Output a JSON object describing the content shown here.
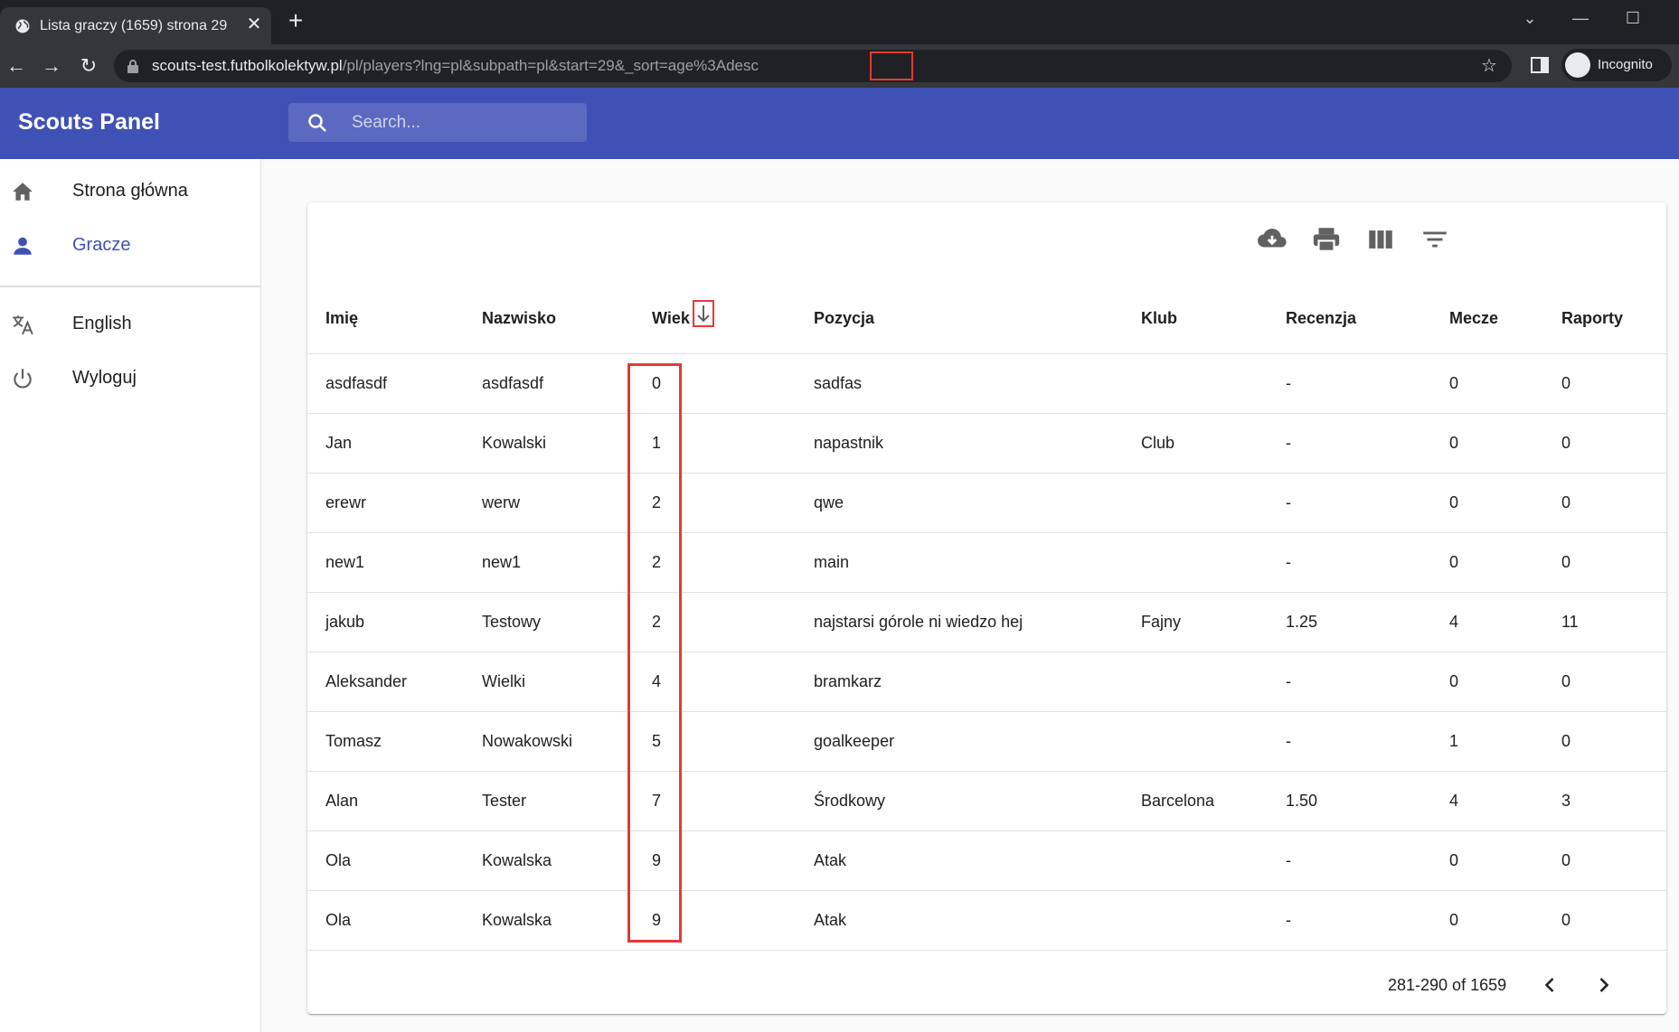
{
  "browser": {
    "tab_title": "Lista graczy (1659) strona 29",
    "url_host": "scouts-test.futbolkolektyw.pl",
    "url_path": "/pl/players?lng=pl&subpath=pl&start=29&_sort=age%3A",
    "url_highlight": "desc",
    "profile_label": "Incognito"
  },
  "app": {
    "title": "Scouts Panel",
    "search_placeholder": "Search..."
  },
  "sidebar": {
    "items": [
      {
        "label": "Strona główna",
        "icon": "home-icon"
      },
      {
        "label": "Gracze",
        "icon": "person-icon",
        "active": true
      },
      {
        "label": "English",
        "icon": "translate-icon"
      },
      {
        "label": "Wyloguj",
        "icon": "power-icon"
      }
    ]
  },
  "table": {
    "columns": [
      "Imię",
      "Nazwisko",
      "Wiek",
      "Pozycja",
      "Klub",
      "Recenzja",
      "Mecze",
      "Raporty"
    ],
    "rows": [
      [
        "asdfasdf",
        "asdfasdf",
        "0",
        "sadfas",
        "",
        "-",
        "0",
        "0"
      ],
      [
        "Jan",
        "Kowalski",
        "1",
        "napastnik",
        "Club",
        "-",
        "0",
        "0"
      ],
      [
        "erewr",
        "werw",
        "2",
        "qwe",
        "",
        "-",
        "0",
        "0"
      ],
      [
        "new1",
        "new1",
        "2",
        "main",
        "",
        "-",
        "0",
        "0"
      ],
      [
        "jakub",
        "Testowy",
        "2",
        "najstarsi górole ni wiedzo hej",
        "Fajny",
        "1.25",
        "4",
        "11"
      ],
      [
        "Aleksander",
        "Wielki",
        "4",
        "bramkarz",
        "",
        "-",
        "0",
        "0"
      ],
      [
        "Tomasz",
        "Nowakowski",
        "5",
        "goalkeeper",
        "",
        "-",
        "1",
        "0"
      ],
      [
        "Alan",
        "Tester",
        "7",
        "Środkowy",
        "Barcelona",
        "1.50",
        "4",
        "3"
      ],
      [
        "Ola",
        "Kowalska",
        "9",
        "Atak",
        "",
        "-",
        "0",
        "0"
      ],
      [
        "Ola",
        "Kowalska",
        "9",
        "Atak",
        "",
        "-",
        "0",
        "0"
      ]
    ],
    "pagination": "281-290 of 1659"
  },
  "colors": {
    "primary": "#3f51b5",
    "highlight": "#e53935"
  }
}
